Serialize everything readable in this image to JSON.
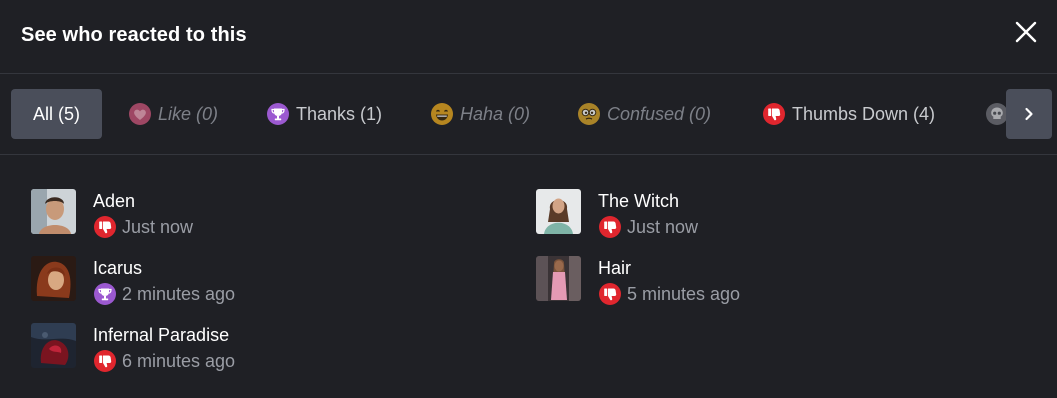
{
  "dialog": {
    "title": "See who reacted to this",
    "close_icon": "close-icon"
  },
  "tabs": [
    {
      "label": "All (5)",
      "icon": "",
      "active": true
    },
    {
      "label": "Like (0)",
      "icon": "heart-icon"
    },
    {
      "label": "Thanks (1)",
      "icon": "trophy-icon"
    },
    {
      "label": "Haha (0)",
      "icon": "laughing-face-icon"
    },
    {
      "label": "Confused (0)",
      "icon": "confused-face-icon"
    },
    {
      "label": "Thumbs Down (4)",
      "icon": "thumbs-down-icon"
    },
    {
      "label": "",
      "icon": "skull-icon"
    }
  ],
  "next_icon": "chevron-right-icon",
  "reactions": [
    {
      "name": "Aden",
      "time": "Just now",
      "reaction": "thumbs-down-icon"
    },
    {
      "name": "The Witch",
      "time": "Just now",
      "reaction": "thumbs-down-icon"
    },
    {
      "name": "Icarus",
      "time": "2 minutes ago",
      "reaction": "trophy-icon"
    },
    {
      "name": "Hair",
      "time": "5 minutes ago",
      "reaction": "thumbs-down-icon"
    },
    {
      "name": "Infernal Paradise",
      "time": "6 minutes ago",
      "reaction": "thumbs-down-icon"
    }
  ],
  "colors": {
    "background": "#1f2025",
    "active_tab": "#4a4e5a",
    "heart": "#e06b8b",
    "trophy": "#9b59d0",
    "thumbs_down": "#e0262e",
    "haha": "#f0b323"
  }
}
